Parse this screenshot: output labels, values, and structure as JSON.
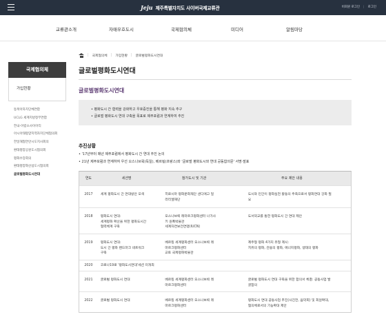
{
  "header": {
    "logo_mark": "Jeju",
    "logo_text": "제주특별자치도 사이버국제교류관",
    "links": [
      "비회원 로그인",
      "로그인"
    ]
  },
  "gnb": [
    "교류관소개",
    "자매우호도시",
    "국제협의체",
    "미디어",
    "알림마당"
  ],
  "sidebar": {
    "title": "국제협의체",
    "sub": "가입현황",
    "items": [
      "동북아자치단체연합",
      "UCLG 세계지방정부연합",
      "한국-아랍소사이어티",
      "아시아태평양지역자치단체협의회",
      "한일해협연안시도지사회의",
      "환태평양공원도시협의회",
      "평화수장회의",
      "환태평양화산섬도시협의회",
      "글로벌평화도시연대"
    ]
  },
  "breadcrumb": [
    "국제협의체",
    "가입현황",
    "글로벌평화도시연대"
  ],
  "page_title": "글로벌평화도시연대",
  "sub_title": "글로벌평화도시연대",
  "box_lines": [
    "• 평화도시 간 협력을 강화하고 우호증진을 통해 평화 지속 추구",
    "• 글로벌 평화도시 연대 구축을 목표로 제주포럼과 연계하여 추진"
  ],
  "section_title": "추진상황",
  "progress": [
    "• '17년부터 매년 제주포럼에서 평화도시 간 연대 추진 논의",
    "• 21년 제주포럼과 연계하여 우선 오스나브뤽(독일), 베르됭(프랑스)와 '글로벌 평화도시와 연대 공동합의문' 서명·발표"
  ],
  "table": {
    "headers": [
      "연도",
      "세션명",
      "참가도시 및 기관",
      "주요 제안 내용"
    ],
    "rows": [
      {
        "year": "2017",
        "session": [
          "세계 평화도시 간 연대방안 모색"
        ],
        "cities": [
          "히로시마 평화문화재단 샌디에고 일",
          "라리엘재단"
        ],
        "content": [
          "도시와 민간이 평화실천 활동의 주축으로서 평화연대 강화 필",
          "요"
        ]
      },
      {
        "year": "2018",
        "session": [
          "평화도시 연대:",
          "세계평화 확산을 위한 평화도시간",
          "협력체계 구축"
        ],
        "cities": [
          "오스나브뤽 레마르크평화센터 나가사",
          "키 원폭박물관",
          "세계자연보전연맹(IUCN)"
        ],
        "content": [
          "도서외교를 통한 평화도시 간 연대 제안"
        ]
      },
      {
        "year": "2019",
        "session": [
          "평화도시 연대:",
          "도시 간 평화 랜드마크 네트워크",
          "구축"
        ],
        "cities": [
          "베르됭 세계평화센터 오스나브뤽 레",
          "마르크평화센터",
          "교토 국제평화박물관"
        ],
        "content": [
          "제주형 평화 4가지 유형 제시:",
          "치유의 평화, 관용의 평화, 에너지평화, 생태의 평화"
        ]
      },
      {
        "year": "2020",
        "span": "코로나19로 '평화도시연대'세션 미개최"
      },
      {
        "year": "2021",
        "session": [
          "글로벌 평화도시 연대"
        ],
        "cities": [
          "베르됭 세계평화센터 오스나브뤽 레",
          "마르크평화센터"
        ],
        "content": [
          "글로벌 평화도시 연대 구축을 위한 합의서 체결: 공동사업 발",
          "굴합의"
        ]
      },
      {
        "year": "2022",
        "session": [
          "글로벌 평화도시 연대"
        ],
        "cities": [
          "베르됭 세계평화센터 오스나브뤽 레",
          "마르크평화센터"
        ],
        "content": [
          "평화도시 연대 공동사업 추진(사진전, 음악회) 및 회원확대,",
          "협의체로서의 기능확대 제안"
        ]
      }
    ]
  }
}
